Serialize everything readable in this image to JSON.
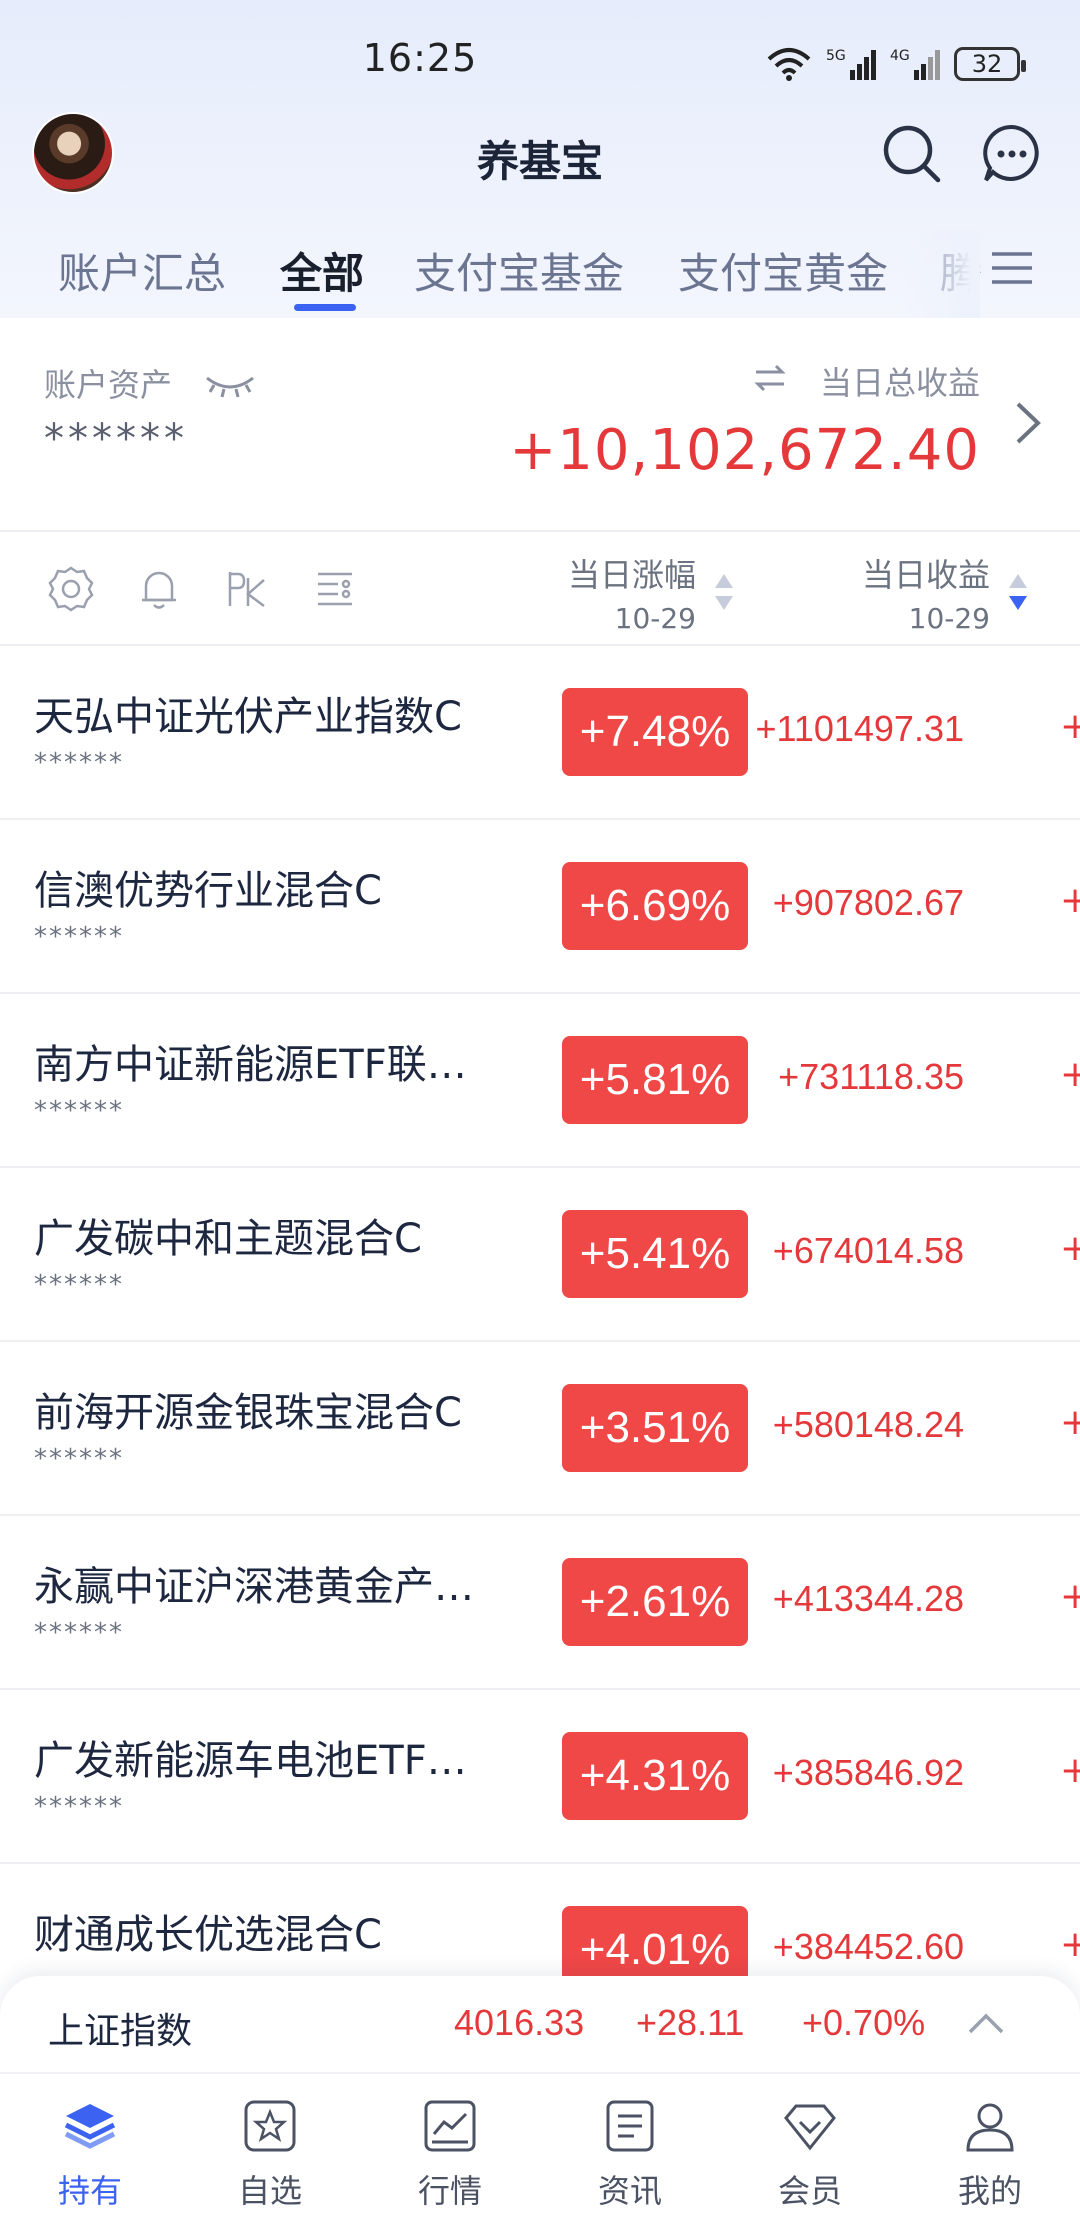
{
  "status_bar": {
    "time": "16:25",
    "battery": "32",
    "net1": "5G",
    "net2": "4G"
  },
  "header": {
    "title": "养基宝"
  },
  "tabs": [
    {
      "label": "账户汇总"
    },
    {
      "label": "全部"
    },
    {
      "label": "支付宝基金"
    },
    {
      "label": "支付宝黄金"
    },
    {
      "label": "腾"
    }
  ],
  "summary": {
    "asset_label": "账户资产",
    "asset_value": "******",
    "profit_label": "当日总收益",
    "profit_value": "+10,102,672.40"
  },
  "columns": {
    "change": {
      "label": "当日涨幅",
      "date": "10-29"
    },
    "profit": {
      "label": "当日收益",
      "date": "10-29"
    }
  },
  "funds": [
    {
      "name": "天弘中证光伏产业指数C",
      "mask": "******",
      "change": "+7.48%",
      "profit": "+1101497.31",
      "extra": "+"
    },
    {
      "name": "信澳优势行业混合C",
      "mask": "******",
      "change": "+6.69%",
      "profit": "+907802.67",
      "extra": "+"
    },
    {
      "name": "南方中证新能源ETF联…",
      "mask": "******",
      "change": "+5.81%",
      "profit": "+731118.35",
      "extra": "+"
    },
    {
      "name": "广发碳中和主题混合C",
      "mask": "******",
      "change": "+5.41%",
      "profit": "+674014.58",
      "extra": "+"
    },
    {
      "name": "前海开源金银珠宝混合C",
      "mask": "******",
      "change": "+3.51%",
      "profit": "+580148.24",
      "extra": "+"
    },
    {
      "name": "永赢中证沪深港黄金产…",
      "mask": "******",
      "change": "+2.61%",
      "profit": "+413344.28",
      "extra": "+"
    },
    {
      "name": "广发新能源车电池ETF…",
      "mask": "******",
      "change": "+4.31%",
      "profit": "+385846.92",
      "extra": "+"
    },
    {
      "name": "财通成长优选混合C",
      "mask": "",
      "change": "+4.01%",
      "profit": "+384452.60",
      "extra": "+"
    }
  ],
  "index": {
    "name": "上证指数",
    "value": "4016.33",
    "change": "+28.11",
    "pct": "+0.70%"
  },
  "nav": [
    {
      "label": "持有"
    },
    {
      "label": "自选"
    },
    {
      "label": "行情"
    },
    {
      "label": "资讯"
    },
    {
      "label": "会员"
    },
    {
      "label": "我的"
    }
  ],
  "colors": {
    "accent": "#3b62f0",
    "up_red": "#e5383b",
    "badge_red": "#f04747"
  }
}
